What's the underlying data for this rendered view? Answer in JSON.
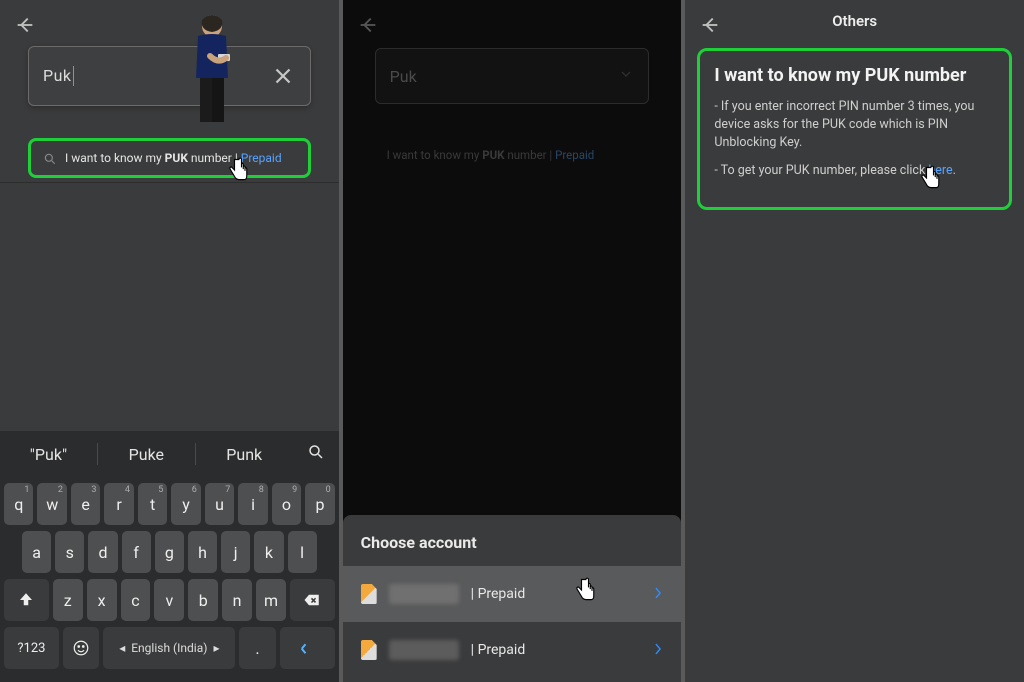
{
  "panel1": {
    "search_value": "Puk",
    "result_prefix": "I want to know my ",
    "result_bold": "PUK",
    "result_suffix": " number | ",
    "result_link": "Prepaid",
    "suggestions": [
      "\"Puk\"",
      "Puke",
      "Punk"
    ],
    "keyboard": {
      "row1": [
        "q",
        "w",
        "e",
        "r",
        "t",
        "y",
        "u",
        "i",
        "o",
        "p"
      ],
      "hints1": [
        "1",
        "2",
        "3",
        "4",
        "5",
        "6",
        "7",
        "8",
        "9",
        "0"
      ],
      "row2": [
        "a",
        "s",
        "d",
        "f",
        "g",
        "h",
        "j",
        "k",
        "l"
      ],
      "row3": [
        "z",
        "x",
        "c",
        "v",
        "b",
        "n",
        "m"
      ],
      "mode_key": "?123",
      "space_label": "English (India)",
      "period_key": "."
    }
  },
  "panel2": {
    "search_value": "Puk",
    "result_prefix": "I want to know my ",
    "result_bold": "PUK",
    "result_suffix": " number | ",
    "result_link": "Prepaid",
    "sheet_title": "Choose account",
    "accounts": [
      {
        "suffix": "| Prepaid"
      },
      {
        "suffix": "| Prepaid"
      }
    ]
  },
  "panel3": {
    "header": "Others",
    "title": "I want to know my PUK number",
    "para1": "- If you enter incorrect PIN number 3 times, you device asks for the PUK code which is PIN Unblocking Key.",
    "para2_pre": "- To get your PUK number, please click ",
    "para2_link": "here",
    "para2_post": "."
  }
}
